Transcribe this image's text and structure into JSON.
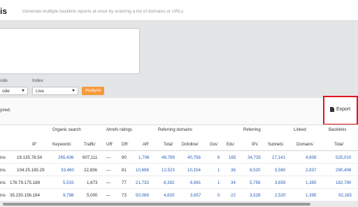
{
  "header": {
    "title": "is",
    "subtitle": "Generate multiple backlink reports at once by entering a list of domains or URLs"
  },
  "controls": {
    "mode_label": "ode",
    "mode_value": "ode",
    "index_label": "Index",
    "index_value": "Live",
    "analyze_label": "Analyze"
  },
  "results": {
    "status_text": "yzed.",
    "export_label": "Export"
  },
  "table": {
    "group_headers": {
      "organic": "Organic search",
      "ahrefs": "Ahrefs ratings",
      "ref_domains": "Referring domains",
      "referring": "Referring",
      "linked": "Linked",
      "backlinks": "Backlinks"
    },
    "column_headers": {
      "ip": "IP",
      "keywords": "Keywords",
      "traffic": "Traffic",
      "ur": "UR",
      "dr": "DR",
      "ar": "AR",
      "total": "Total",
      "dofollow": "Dofollow",
      "gov": "Gov",
      "edu": "Edu",
      "ips": "IPs",
      "subnets": "Subnets",
      "domains": "Domains",
      "bl_total": "Total"
    },
    "rows": [
      {
        "name": "ins",
        "ip": "18.135.78.54",
        "keywords": "265,436",
        "traffic": "607,111",
        "ur": "—",
        "dr": "90",
        "ar": "1,706",
        "total": "48,789",
        "dofollow": "40,756",
        "gov": "6",
        "edu": "165",
        "ips": "34,735",
        "subnets": "17,141",
        "domains": "4,608",
        "bl_total": "525,010"
      },
      {
        "name": "ins",
        "ip": "104.25.185.29",
        "keywords": "33,460",
        "traffic": "22,836",
        "ur": "—",
        "dr": "81",
        "ar": "10,698",
        "total": "12,523",
        "dofollow": "10,154",
        "gov": "1",
        "edu": "36",
        "ips": "8,520",
        "subnets": "5,560",
        "domains": "2,837",
        "bl_total": "290,406"
      },
      {
        "name": "ins",
        "ip": "178.79.175.188",
        "keywords": "5,533",
        "traffic": "1,673",
        "ur": "—",
        "dr": "77",
        "ar": "21,733",
        "total": "8,392",
        "dofollow": "6,861",
        "gov": "1",
        "edu": "34",
        "ips": "5,756",
        "subnets": "3,859",
        "domains": "1,385",
        "bl_total": "182,780"
      },
      {
        "name": "ins",
        "ip": "35.230.156.184",
        "keywords": "9,788",
        "traffic": "5,000",
        "ur": "—",
        "dr": "73",
        "ar": "50,089",
        "total": "4,820",
        "dofollow": "3,657",
        "gov": "0",
        "edu": "22",
        "ips": "3,528",
        "subnets": "2,520",
        "domains": "1,395",
        "bl_total": "92,165"
      }
    ]
  },
  "colors": {
    "accent_orange": "#f59a3b",
    "link_blue": "#2a60b8",
    "highlight_red": "#e2161b"
  }
}
